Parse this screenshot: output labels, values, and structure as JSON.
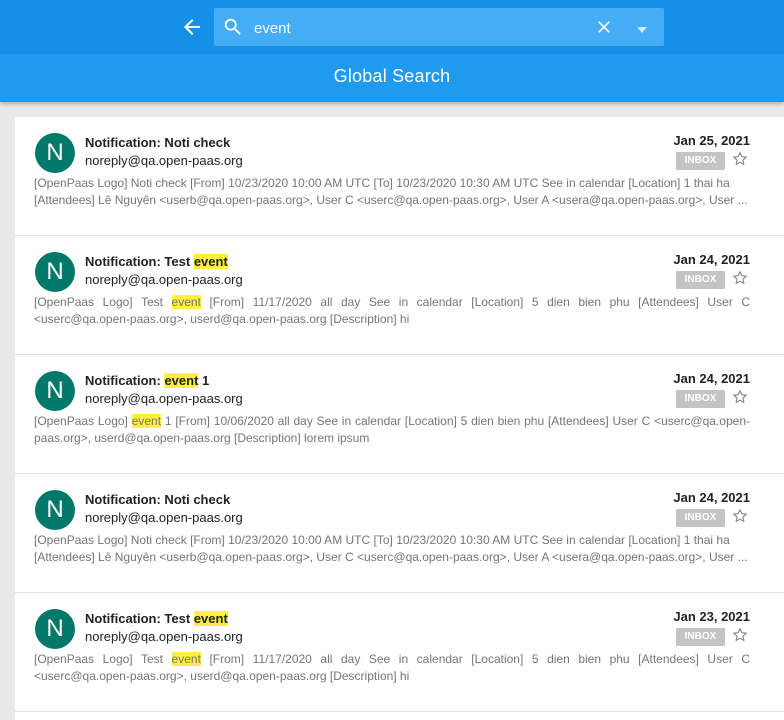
{
  "search": {
    "value": "event"
  },
  "title": "Global Search",
  "colors": {
    "header": "#1e9bf0",
    "avatar": "#00796b",
    "highlight": "#ffef40"
  },
  "icons": {
    "back": "arrow-left",
    "search": "magnifier",
    "clear": "x",
    "dropdown": "caret-down",
    "star": "star-outline"
  },
  "results": [
    {
      "avatar": "N",
      "subject": [
        "Notification: Noti check",
        "",
        ""
      ],
      "sender": "noreply@qa.open-paas.org",
      "date": "Jan 25, 2021",
      "folder": "INBOX",
      "preview_lines": [
        "[OpenPaas Logo] Noti check [From] 10/23/2020 10:00 AM UTC [To] 10/23/2020 10:30 AM UTC See in calendar [Location] 1 thai ha",
        "[Attendees] Lê Nguyên <userb@qa.open-paas.org>, User C <userc@qa.open-paas.org>, User A <usera@qa.open-paas.org>, User ..."
      ]
    },
    {
      "avatar": "N",
      "subject": [
        "Notification: Test ",
        "event",
        ""
      ],
      "sender": "noreply@qa.open-paas.org",
      "date": "Jan 24, 2021",
      "folder": "INBOX",
      "preview": [
        "[OpenPaas Logo] Test ",
        "event",
        " [From] 11/17/2020 all day See in calendar [Location] 5 dien bien phu [Attendees] User C <userc@qa.open-paas.org>, userd@qa.open-paas.org [Description] hi"
      ]
    },
    {
      "avatar": "N",
      "subject": [
        "Notification: ",
        "event",
        " 1"
      ],
      "sender": "noreply@qa.open-paas.org",
      "date": "Jan 24, 2021",
      "folder": "INBOX",
      "preview": [
        "[OpenPaas Logo] ",
        "event",
        " 1 [From] 10/06/2020 all day See in calendar [Location] 5 dien bien phu [Attendees] User C <userc@qa.open-paas.org>, userd@qa.open-paas.org [Description] lorem ipsum"
      ]
    },
    {
      "avatar": "N",
      "subject": [
        "Notification: Noti check",
        "",
        ""
      ],
      "sender": "noreply@qa.open-paas.org",
      "date": "Jan 24, 2021",
      "folder": "INBOX",
      "preview_lines": [
        "[OpenPaas Logo] Noti check [From] 10/23/2020 10:00 AM UTC [To] 10/23/2020 10:30 AM UTC See in calendar [Location] 1 thai ha",
        "[Attendees] Lê Nguyên <userb@qa.open-paas.org>, User C <userc@qa.open-paas.org>, User A <usera@qa.open-paas.org>, User ..."
      ]
    },
    {
      "avatar": "N",
      "subject": [
        "Notification: Test ",
        "event",
        ""
      ],
      "sender": "noreply@qa.open-paas.org",
      "date": "Jan 23, 2021",
      "folder": "INBOX",
      "preview": [
        "[OpenPaas Logo] Test ",
        "event",
        " [From] 11/17/2020 all day See in calendar [Location] 5 dien bien phu [Attendees] User C <userc@qa.open-paas.org>, userd@qa.open-paas.org [Description] hi"
      ]
    }
  ]
}
